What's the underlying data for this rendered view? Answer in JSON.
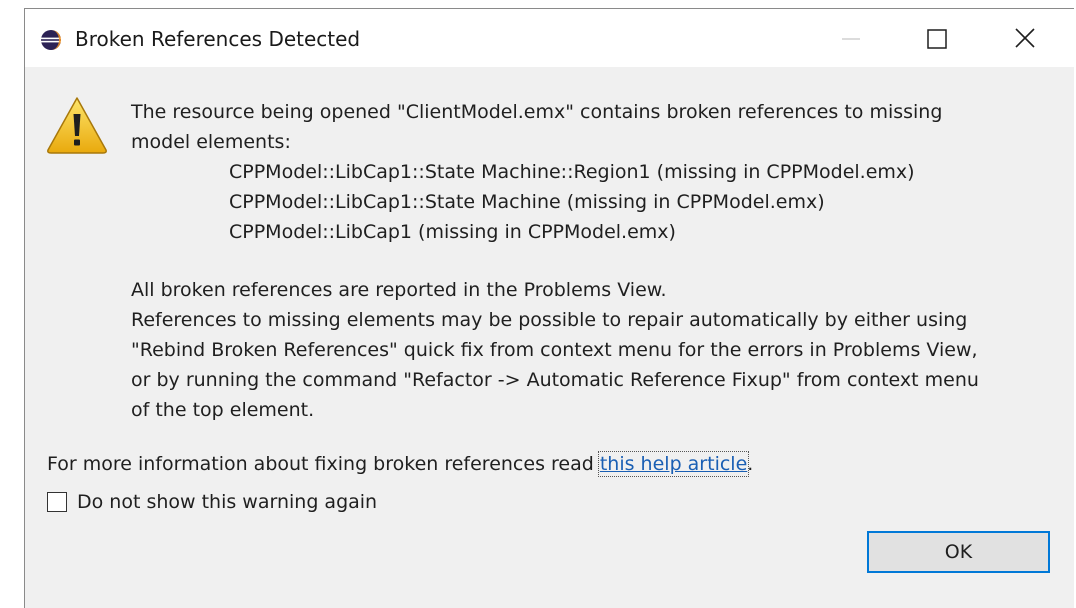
{
  "window": {
    "title": "Broken References Detected",
    "icon": "eclipse-icon"
  },
  "titlebar_buttons": {
    "minimize": "minimize-icon",
    "maximize": "maximize-icon",
    "close": "close-icon"
  },
  "message": {
    "icon": "warning-icon",
    "intro_line1": "The resource being opened \"ClientModel.emx\" contains broken references to missing",
    "intro_line2": "model elements:",
    "missing_elements": [
      "CPPModel::LibCap1::State Machine::Region1 (missing in CPPModel.emx)",
      "CPPModel::LibCap1::State Machine (missing in CPPModel.emx)",
      "CPPModel::LibCap1 (missing in CPPModel.emx)"
    ],
    "details": [
      "All broken references are reported in the Problems View.",
      "References to missing elements may be possible to repair automatically by either using",
      "\"Rebind Broken References\" quick fix from context menu for the errors in Problems View,",
      "or by running the command \"Refactor -> Automatic Reference Fixup\" from context menu",
      "of the top element."
    ]
  },
  "info": {
    "text": "For more information about fixing broken references read ",
    "link_text": "this help article",
    "suffix": "."
  },
  "checkbox": {
    "label": "Do not show this warning again",
    "checked": false
  },
  "buttons": {
    "ok": "OK"
  },
  "colors": {
    "accent": "#0078d7",
    "link": "#1a5fb4",
    "warning": "#f7c21c",
    "dialog_bg": "#f0f0f0"
  }
}
